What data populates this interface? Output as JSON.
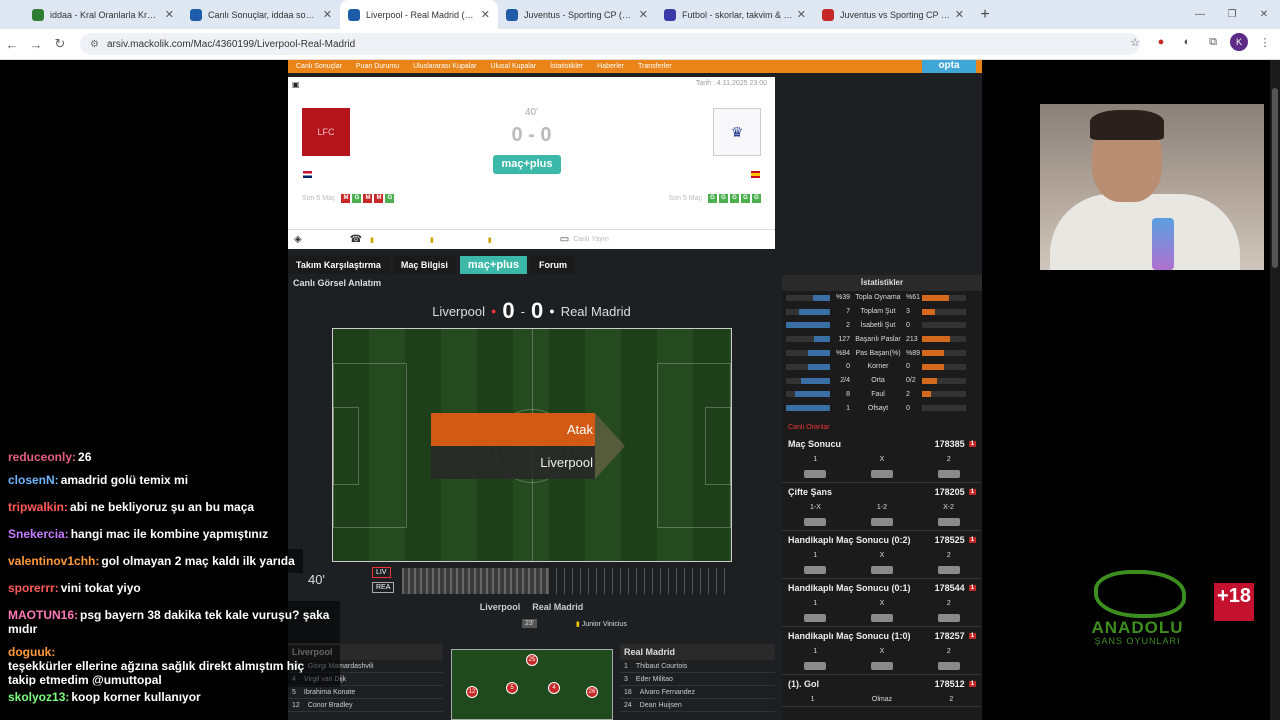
{
  "browser": {
    "tabs": [
      {
        "title": "iddaa - Kral Oranlarla Kralar Gi",
        "color": "#2e7d32"
      },
      {
        "title": "Canlı Sonuçlar, iddaa sonuçları",
        "color": "#1e5ba8"
      },
      {
        "title": "Liverpool - Real Madrid (4.11.20",
        "color": "#1e5ba8"
      },
      {
        "title": "Juventus - Sporting CP (4.11.20",
        "color": "#1e5ba8"
      },
      {
        "title": "Futbol - skorlar, takvim & oran",
        "color": "#3a3aa8"
      },
      {
        "title": "Juventus vs Sporting CP - 4 No",
        "color": "#c62828"
      }
    ],
    "url": "arsiv.mackolik.com/Mac/4360199/Liverpool-Real-Madrid",
    "profile": "K"
  },
  "site_nav": [
    "Canlı Sonuçlar",
    "Puan Durumu",
    "Uluslararası Kupalar",
    "Ulusal Kupalar",
    "İstatistikler",
    "Haberler",
    "Transferler"
  ],
  "site_badge": "opta",
  "match": {
    "date": "Tarih : 4.11.2025 23:00",
    "minute": "40'",
    "score": "0 - 0",
    "macplus": "maç+plus",
    "home_logo_text": "LFC",
    "home_form_label": "Son 5 Maç",
    "home_form": [
      "M",
      "G",
      "M",
      "M",
      "G"
    ],
    "away_form_label": "Son 5 Maç",
    "away_form": [
      "G",
      "G",
      "G",
      "G",
      "G"
    ],
    "tv_label": "Canlı Yayın"
  },
  "tabs": [
    "Takım Karşılaştırma",
    "Maç Bilgisi",
    "maç+plus",
    "Forum"
  ],
  "visual": {
    "title": "Canlı Görsel Anlatım",
    "home": "Liverpool",
    "away": "Real Madrid",
    "home_score": "0",
    "away_score": "0",
    "event": "Atak",
    "event_team": "Liverpool",
    "minute": "40'",
    "home_abbr": "LIV",
    "away_abbr": "REA"
  },
  "events": {
    "home": "Liverpool",
    "away": "Real Madrid",
    "minute": "23'",
    "player": "Junior Vinicius"
  },
  "lineups": {
    "home_title": "Liverpool",
    "home": [
      {
        "no": "25",
        "name": "Giorgi Mamardashvili"
      },
      {
        "no": "4",
        "name": "Virgil van Dijk"
      },
      {
        "no": "5",
        "name": "Ibrahima Konate"
      },
      {
        "no": "12",
        "name": "Conor Bradley"
      }
    ],
    "away_title": "Real Madrid",
    "away": [
      {
        "no": "1",
        "name": "Thibaut Courtois"
      },
      {
        "no": "3",
        "name": "Eder Militao"
      },
      {
        "no": "18",
        "name": "Alvaro Fernandez"
      },
      {
        "no": "24",
        "name": "Dean Huijsen"
      }
    ],
    "mini_pitch_numbers": [
      "25",
      "12",
      "5",
      "4",
      "26"
    ]
  },
  "stats": {
    "title": "İstatistikler",
    "rows": [
      {
        "l": "%39",
        "name": "Topla Oynama",
        "r": "%61",
        "lp": 0.39,
        "rp": 0.61
      },
      {
        "l": "7",
        "name": "Toplam Şut",
        "r": "3",
        "lp": 0.7,
        "rp": 0.3
      },
      {
        "l": "2",
        "name": "İsabetli Şut",
        "r": "0",
        "lp": 1.0,
        "rp": 0.0
      },
      {
        "l": "127",
        "name": "Başarılı Paslar",
        "r": "213",
        "lp": 0.37,
        "rp": 0.63
      },
      {
        "l": "%84",
        "name": "Pas Başarı(%)",
        "r": "%89",
        "lp": 0.49,
        "rp": 0.51
      },
      {
        "l": "0",
        "name": "Korner",
        "r": "0",
        "lp": 0.5,
        "rp": 0.5
      },
      {
        "l": "2/4",
        "name": "Orta",
        "r": "0/2",
        "lp": 0.67,
        "rp": 0.33
      },
      {
        "l": "8",
        "name": "Faul",
        "r": "2",
        "lp": 0.8,
        "rp": 0.2
      },
      {
        "l": "1",
        "name": "Ofsayt",
        "r": "0",
        "lp": 1.0,
        "rp": 0.0
      }
    ]
  },
  "odds": {
    "title": "Canlı Oranlar",
    "blocks": [
      {
        "name": "Maç Sonucu",
        "id": "178385",
        "cols": [
          "1",
          "X",
          "2"
        ]
      },
      {
        "name": "Çifte Şans",
        "id": "178205",
        "cols": [
          "1-X",
          "1-2",
          "X-2"
        ]
      },
      {
        "name": "Handikaplı Maç Sonucu (0:2)",
        "id": "178525",
        "cols": [
          "1",
          "X",
          "2"
        ]
      },
      {
        "name": "Handikaplı Maç Sonucu (0:1)",
        "id": "178544",
        "cols": [
          "1",
          "X",
          "2"
        ]
      },
      {
        "name": "Handikaplı Maç Sonucu (1:0)",
        "id": "178257",
        "cols": [
          "1",
          "X",
          "2"
        ]
      },
      {
        "name": "(1). Gol",
        "id": "178512",
        "cols": [
          "1",
          "Olmaz",
          "2"
        ]
      }
    ],
    "badge": "1"
  },
  "chat": [
    {
      "user": "reduceonly:",
      "msg": "26",
      "color": "#e0607e"
    },
    {
      "user": "closenN:",
      "msg": "amadrid golü temix mi",
      "color": "#6fb6ff"
    },
    {
      "user": "tripwalkin:",
      "msg": "abi ne bekliyoruz şu an bu maça",
      "color": "#ff5a5a"
    },
    {
      "user": "Snekercia:",
      "msg": "hangi mac ile kombine yapmıştınız",
      "color": "#c77dff"
    },
    {
      "user": "valentinov1chh:",
      "msg": "gol olmayan 2 maç kaldı ilk yarıda",
      "color": "#ff9a3c"
    },
    {
      "user": "sporerrr:",
      "msg": "vini tokat yiyo",
      "color": "#ff5a5a"
    },
    {
      "user": "MAOTUN16:",
      "msg": "psg bayern 38 dakika tek kale vuruşu? şaka",
      "msg2": "mıdır",
      "color": "#ff7ab6"
    },
    {
      "user": "doguuk:",
      "msg": "teşekkürler ellerine ağzına sağlık direkt almıştım hiç",
      "msg2": "takip etmedim @umuttopal",
      "color": "#ff9a3c"
    },
    {
      "user": "skolyoz13:",
      "msg": "koop korner kullanıyor",
      "color": "#7dff7d"
    }
  ],
  "overlay": {
    "brand": "ANADOLU",
    "brand_sub": "ŞANS OYUNLARI",
    "age": "+18"
  }
}
